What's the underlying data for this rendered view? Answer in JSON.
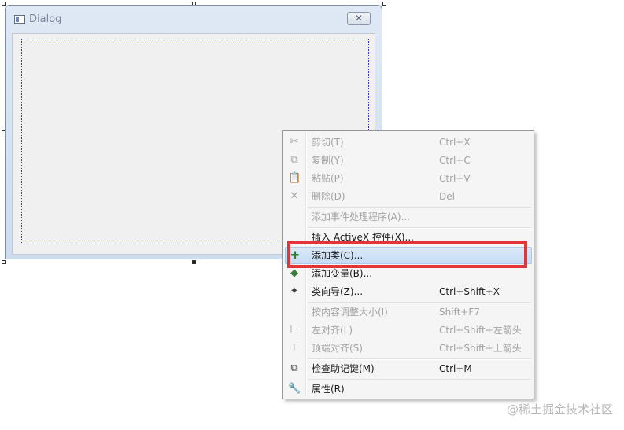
{
  "dialog": {
    "title": "Dialog",
    "close_glyph": "✕"
  },
  "menu": {
    "items": [
      {
        "label": "剪切(T)",
        "shortcut": "Ctrl+X",
        "icon": "scissors-icon",
        "glyph": "✂",
        "enabled": false
      },
      {
        "label": "复制(Y)",
        "shortcut": "Ctrl+C",
        "icon": "copy-icon",
        "glyph": "⧉",
        "enabled": false
      },
      {
        "label": "粘贴(P)",
        "shortcut": "Ctrl+V",
        "icon": "paste-icon",
        "glyph": "📋",
        "enabled": false
      },
      {
        "label": "删除(D)",
        "shortcut": "Del",
        "icon": "delete-icon",
        "glyph": "✕",
        "enabled": false
      },
      {
        "label": "添加事件处理程序(A)...",
        "shortcut": "",
        "icon": "",
        "glyph": "",
        "enabled": false
      },
      {
        "label": "插入 ActiveX 控件(X)...",
        "shortcut": "",
        "icon": "",
        "glyph": "",
        "enabled": true
      },
      {
        "label": "添加类(C)...",
        "shortcut": "",
        "icon": "add-class-icon",
        "glyph": "✚",
        "enabled": true,
        "highlighted": true
      },
      {
        "label": "添加变量(B)...",
        "shortcut": "",
        "icon": "add-variable-icon",
        "glyph": "◆",
        "enabled": true
      },
      {
        "label": "类向导(Z)...",
        "shortcut": "Ctrl+Shift+X",
        "icon": "class-wizard-icon",
        "glyph": "✦",
        "enabled": true
      },
      {
        "label": "按内容调整大小(I)",
        "shortcut": "Shift+F7",
        "icon": "",
        "glyph": "",
        "enabled": false
      },
      {
        "label": "左对齐(L)",
        "shortcut": "Ctrl+Shift+左箭头",
        "icon": "align-left-icon",
        "glyph": "⊢",
        "enabled": false
      },
      {
        "label": "顶端对齐(S)",
        "shortcut": "Ctrl+Shift+上箭头",
        "icon": "align-top-icon",
        "glyph": "⊤",
        "enabled": false
      },
      {
        "label": "检查助记键(M)",
        "shortcut": "Ctrl+M",
        "icon": "check-mnemonics-icon",
        "glyph": "⧉",
        "enabled": true
      },
      {
        "label": "属性(R)",
        "shortcut": "",
        "icon": "wrench-icon",
        "glyph": "🔧",
        "enabled": true
      }
    ]
  },
  "watermark": "@稀土掘金技术社区",
  "colors": {
    "highlight_border": "#e5333a",
    "menu_hover": "#c6dcf5"
  }
}
